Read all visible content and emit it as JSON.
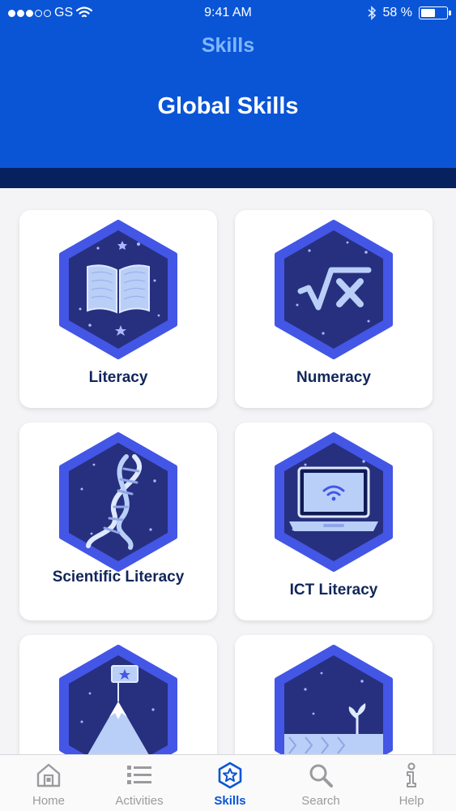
{
  "status_bar": {
    "carrier": "GS",
    "time": "9:41 AM",
    "battery": "58 %",
    "battery_level": 0.58
  },
  "header": {
    "nav_title": "Skills",
    "page_title": "Global Skills"
  },
  "skills": [
    {
      "label": "Literacy",
      "icon": "book-icon"
    },
    {
      "label": "Numeracy",
      "icon": "square-root-x-icon"
    },
    {
      "label": "Scientific Literacy",
      "icon": "dna-icon"
    },
    {
      "label": "ICT Literacy",
      "icon": "laptop-wifi-icon"
    },
    {
      "label": "",
      "icon": "mountain-flag-icon"
    },
    {
      "label": "",
      "icon": "sprout-icon"
    }
  ],
  "tabbar": {
    "tabs": [
      {
        "label": "Home",
        "icon": "home-icon"
      },
      {
        "label": "Activities",
        "icon": "list-icon"
      },
      {
        "label": "Skills",
        "icon": "star-badge-icon",
        "active": true
      },
      {
        "label": "Search",
        "icon": "search-icon"
      },
      {
        "label": "Help",
        "icon": "info-icon"
      }
    ]
  },
  "colors": {
    "header_blue": "#0a55d6",
    "dark_band": "#06215e",
    "badge_outer": "#4356e6",
    "badge_inner": "#27307f",
    "label_navy": "#11265a",
    "inactive_tab": "#9b9b9f"
  }
}
